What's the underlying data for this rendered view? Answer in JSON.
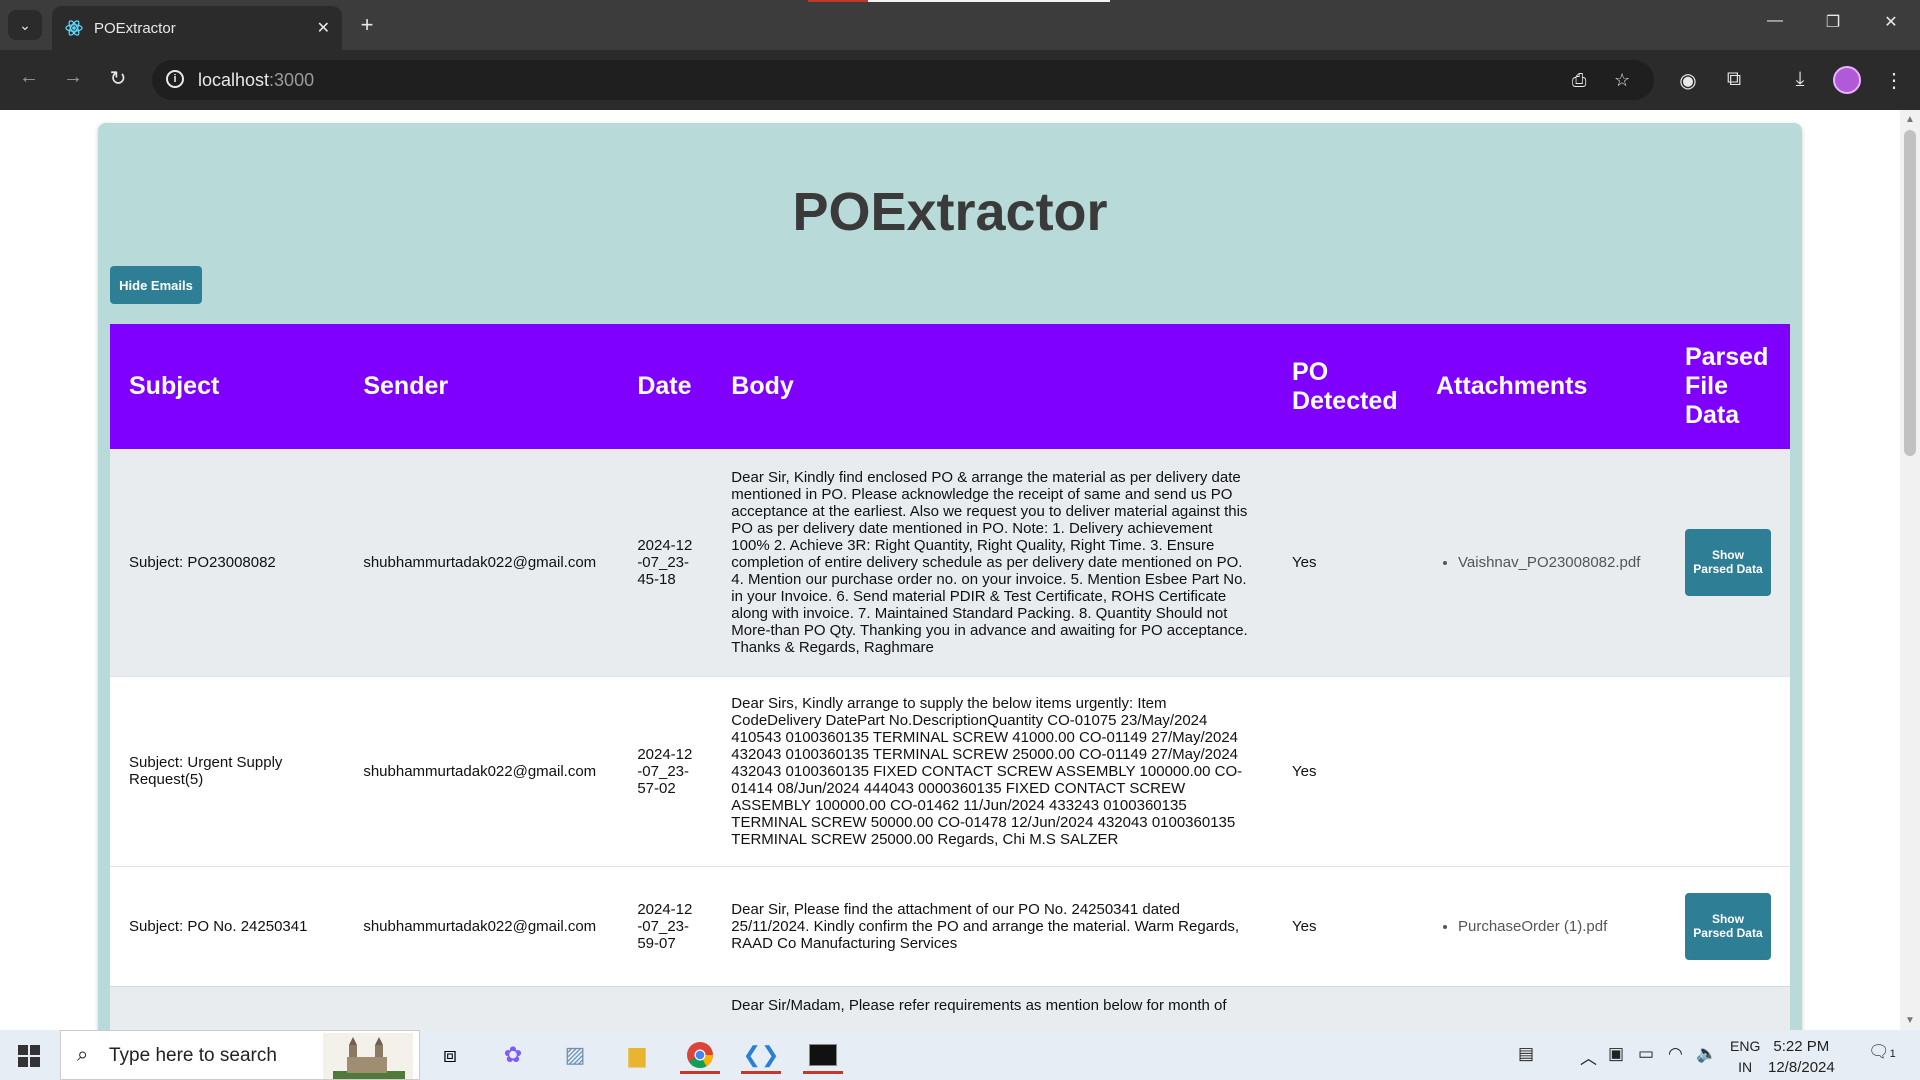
{
  "browser": {
    "tab_title": "POExtractor",
    "url_host": "localhost",
    "url_port": ":3000"
  },
  "app": {
    "title": "POExtractor",
    "hide_emails_label": "Hide Emails"
  },
  "table": {
    "headers": {
      "subject": "Subject",
      "sender": "Sender",
      "date": "Date",
      "body": "Body",
      "po_detected": "PO Detected",
      "attachments": "Attachments",
      "parsed": "Parsed File Data"
    },
    "rows": [
      {
        "subject": "Subject: PO23008082",
        "sender": "shubhammurtadak022@gmail.com",
        "date": "2024-12-07_23-45-18",
        "body": "Dear Sir, Kindly find enclosed PO & arrange the material as per delivery date mentioned in PO. Please acknowledge the receipt of same and send us PO acceptance at the earliest. Also we request you to deliver material against this PO as per delivery date mentioned in PO. Note: 1. Delivery achievement 100% 2. Achieve 3R: Right Quantity, Right Quality, Right Time. 3. Ensure completion of entire delivery schedule as per delivery date mentioned on PO. 4. Mention our purchase order no. on your invoice. 5. Mention Esbee Part No. in your Invoice. 6. Send material PDIR & Test Certificate, ROHS Certificate along with invoice. 7. Maintained Standard Packing. 8. Quantity Should not More-than PO Qty. Thanking you in advance and awaiting for PO acceptance. Thanks & Regards, Raghmare",
        "po_detected": "Yes",
        "attachment": "Vaishnav_PO23008082.pdf",
        "button": "Show Parsed Data"
      },
      {
        "subject": "Subject: Urgent Supply Request(5)",
        "sender": "shubhammurtadak022@gmail.com",
        "date": "2024-12-07_23-57-02",
        "body": "Dear Sirs, Kindly arrange to supply the below items urgently: Item CodeDelivery DatePart No.DescriptionQuantity CO-01075 23/May/2024 410543 0100360135 TERMINAL SCREW 41000.00 CO-01149 27/May/2024 432043 0100360135 TERMINAL SCREW 25000.00 CO-01149 27/May/2024 432043 0100360135 FIXED CONTACT SCREW ASSEMBLY 100000.00 CO-01414 08/Jun/2024 444043 0000360135 FIXED CONTACT SCREW ASSEMBLY 100000.00 CO-01462 11/Jun/2024 433243 0100360135 TERMINAL SCREW 50000.00 CO-01478 12/Jun/2024 432043 0100360135 TERMINAL SCREW 25000.00 Regards, Chi M.S SALZER",
        "po_detected": "Yes"
      },
      {
        "subject": "Subject: PO No. 24250341",
        "sender": "shubhammurtadak022@gmail.com",
        "date": "2024-12-07_23-59-07",
        "body": "Dear Sir, Please find the attachment of our PO No. 24250341 dated 25/11/2024. Kindly confirm the PO and arrange the material. Warm Regards, RAAD Co Manufacturing Services",
        "po_detected": "Yes",
        "attachment": "PurchaseOrder (1).pdf",
        "button": "Show Parsed Data"
      },
      {
        "body": "Dear Sir/Madam, Please refer requirements as mention below for month of"
      }
    ]
  },
  "taskbar": {
    "search_placeholder": "Type here to search",
    "lang_top": "ENG",
    "lang_bottom": "IN",
    "time": "5:22 PM",
    "date": "12/8/2024",
    "notif_count": "1"
  }
}
